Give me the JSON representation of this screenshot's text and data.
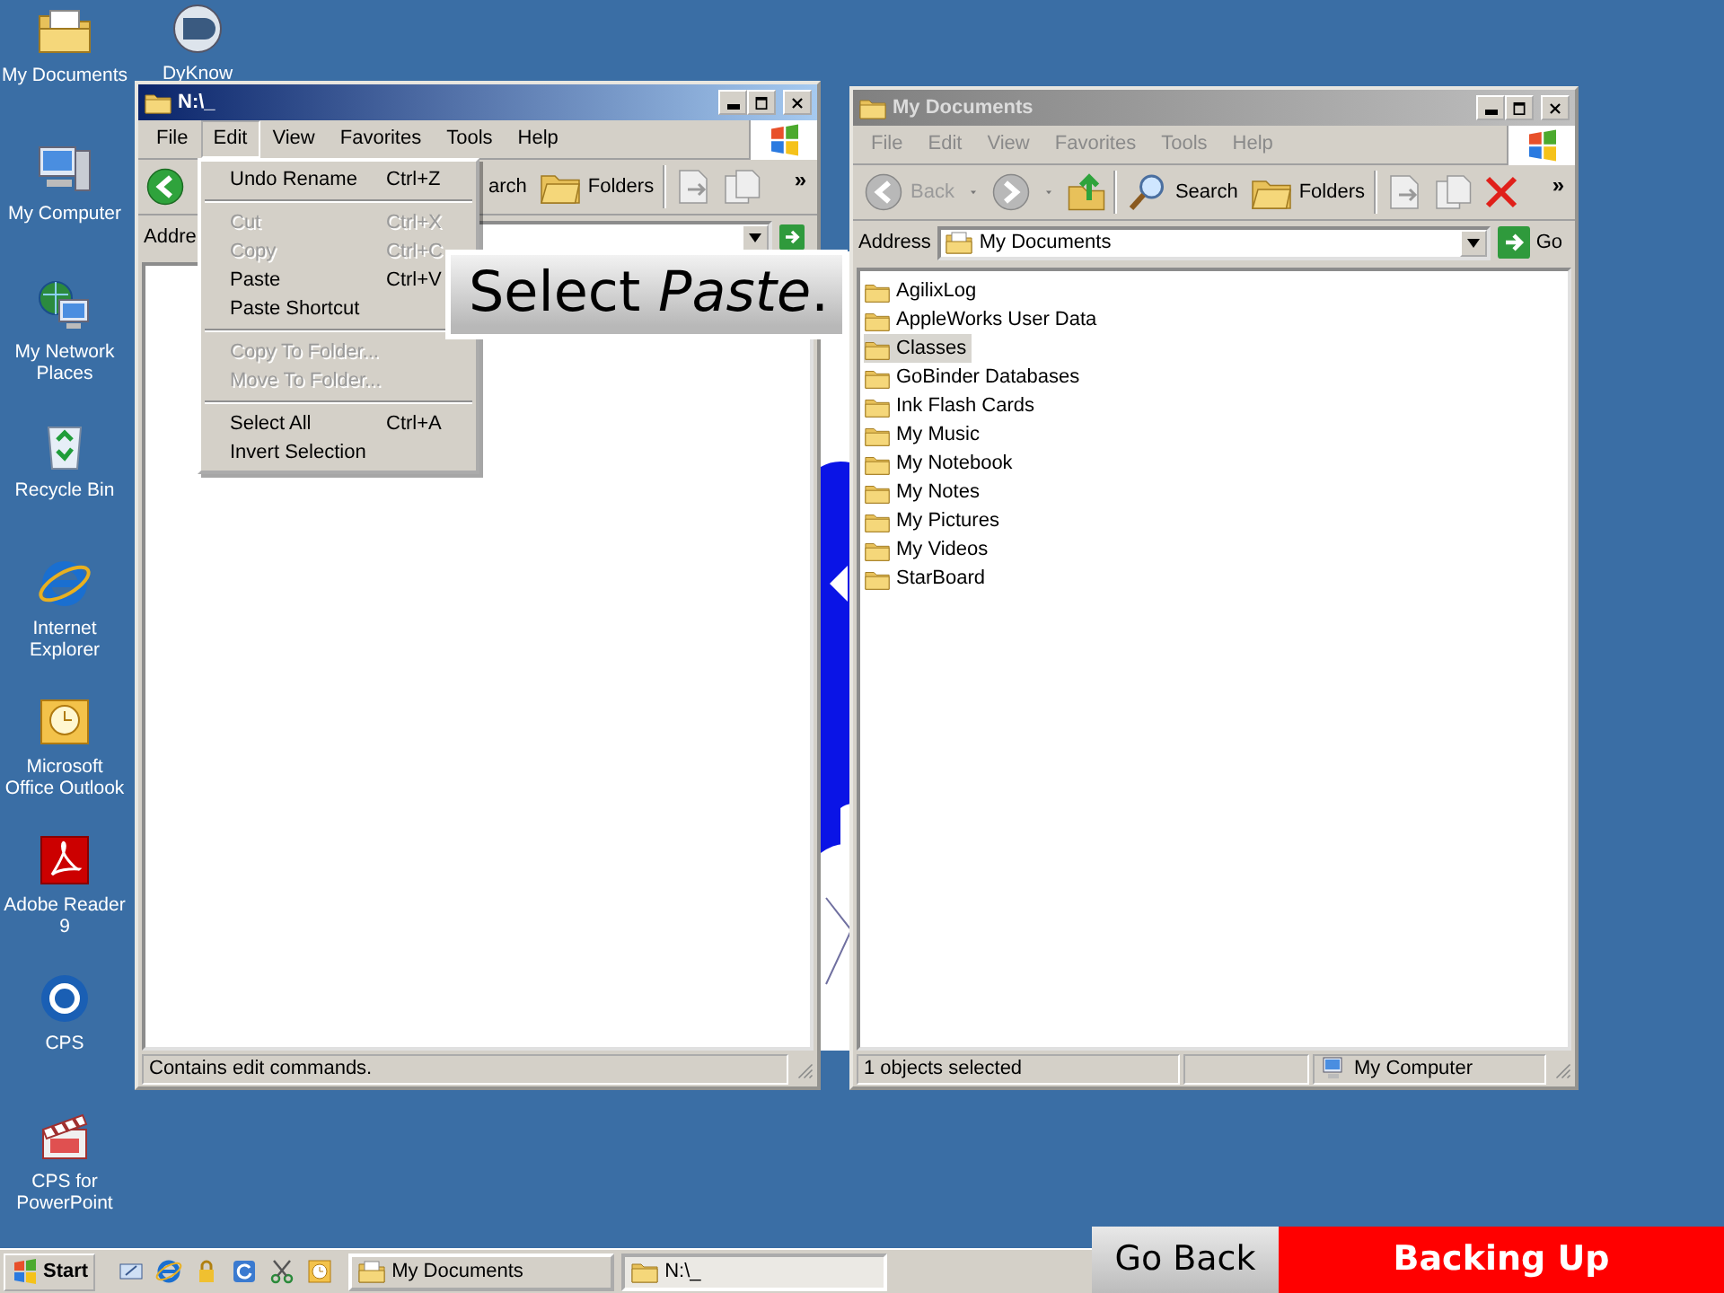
{
  "desktop_icons": [
    {
      "label": "My Documents",
      "kind": "documents"
    },
    {
      "label": "My Computer",
      "kind": "computer"
    },
    {
      "label": "My Network Places",
      "kind": "network"
    },
    {
      "label": "Recycle Bin",
      "kind": "recycle"
    },
    {
      "label": "Internet Explorer",
      "kind": "ie"
    },
    {
      "label": "Microsoft Office Outlook",
      "kind": "outlook"
    },
    {
      "label": "Adobe Reader 9",
      "kind": "pdf"
    },
    {
      "label": "CPS",
      "kind": "cps"
    },
    {
      "label": "CPS for PowerPoint",
      "kind": "clapper"
    }
  ],
  "desktop_shortcut": {
    "label": "DyKnow",
    "kind": "dyknow"
  },
  "windows": [
    {
      "title": "N:\\_",
      "active": true,
      "menu": [
        {
          "label": "File",
          "open": false
        },
        {
          "label": "Edit",
          "open": true
        },
        {
          "label": "View",
          "open": false
        },
        {
          "label": "Favorites",
          "open": false
        },
        {
          "label": "Tools",
          "open": false
        },
        {
          "label": "Help",
          "open": false
        }
      ],
      "toolbar": [
        {
          "kind": "back",
          "disabled": false
        },
        {
          "kind": "text",
          "label": "arch"
        },
        {
          "kind": "folders",
          "label": "Folders"
        },
        {
          "kind": "sep"
        },
        {
          "kind": "move"
        },
        {
          "kind": "copy"
        }
      ],
      "chevron": "»",
      "address": {
        "label": "Addre"
      },
      "status": {
        "text": "Contains edit commands."
      }
    },
    {
      "title": "My Documents",
      "active": false,
      "menu": [
        {
          "label": "File",
          "open": false
        },
        {
          "label": "Edit",
          "open": false
        },
        {
          "label": "View",
          "open": false
        },
        {
          "label": "Favorites",
          "open": false
        },
        {
          "label": "Tools",
          "open": false
        },
        {
          "label": "Help",
          "open": false
        }
      ],
      "toolbar": [
        {
          "kind": "back",
          "label": "Back",
          "disabled": true
        },
        {
          "kind": "drop"
        },
        {
          "kind": "forward",
          "disabled": true
        },
        {
          "kind": "drop"
        },
        {
          "kind": "up"
        },
        {
          "kind": "sep"
        },
        {
          "kind": "search",
          "label": "Search"
        },
        {
          "kind": "folders",
          "label": "Folders"
        },
        {
          "kind": "sep"
        },
        {
          "kind": "move"
        },
        {
          "kind": "copy"
        },
        {
          "kind": "delete"
        }
      ],
      "chevron": "»",
      "address": {
        "label": "Address",
        "value": "My Documents",
        "go": "Go"
      },
      "files": [
        {
          "name": "AgilixLog",
          "selected": false
        },
        {
          "name": "AppleWorks User Data",
          "selected": false
        },
        {
          "name": "Classes",
          "selected": true
        },
        {
          "name": "GoBinder Databases",
          "selected": false
        },
        {
          "name": "Ink Flash Cards",
          "selected": false
        },
        {
          "name": "My Music",
          "selected": false
        },
        {
          "name": "My Notebook",
          "selected": false
        },
        {
          "name": "My Notes",
          "selected": false
        },
        {
          "name": "My Pictures",
          "selected": false
        },
        {
          "name": "My Videos",
          "selected": false
        },
        {
          "name": "StarBoard",
          "selected": false
        }
      ],
      "status": {
        "text": "1 objects selected",
        "zone": "My Computer"
      }
    }
  ],
  "edit_menu": [
    {
      "kind": "item",
      "label": "Undo Rename",
      "shortcut": "Ctrl+Z",
      "disabled": false
    },
    {
      "kind": "separator"
    },
    {
      "kind": "item",
      "label": "Cut",
      "shortcut": "Ctrl+X",
      "disabled": true
    },
    {
      "kind": "item",
      "label": "Copy",
      "shortcut": "Ctrl+C",
      "disabled": true
    },
    {
      "kind": "item",
      "label": "Paste",
      "shortcut": "Ctrl+V",
      "disabled": false
    },
    {
      "kind": "item",
      "label": "Paste Shortcut",
      "disabled": false
    },
    {
      "kind": "separator"
    },
    {
      "kind": "item",
      "label": "Copy To Folder...",
      "disabled": true
    },
    {
      "kind": "item",
      "label": "Move To Folder...",
      "disabled": true
    },
    {
      "kind": "separator"
    },
    {
      "kind": "item",
      "label": "Select All",
      "shortcut": "Ctrl+A",
      "disabled": false
    },
    {
      "kind": "item",
      "label": "Invert Selection",
      "disabled": false
    }
  ],
  "callout": "Select *Paste*.",
  "taskbar": {
    "start": "Start",
    "quick_launch": [
      {
        "kind": "desktop"
      },
      {
        "kind": "ie"
      },
      {
        "kind": "lock"
      },
      {
        "kind": "refresh"
      },
      {
        "kind": "tools"
      },
      {
        "kind": "clock"
      }
    ],
    "tasks": [
      {
        "label": "My Documents",
        "kind": "documents",
        "selected": false
      },
      {
        "label": "N:\\_",
        "kind": "folder",
        "selected": true
      }
    ]
  },
  "slide_nav": [
    {
      "label": "Go Back",
      "selected": false
    },
    {
      "label": "Backing Up",
      "selected": true
    }
  ]
}
